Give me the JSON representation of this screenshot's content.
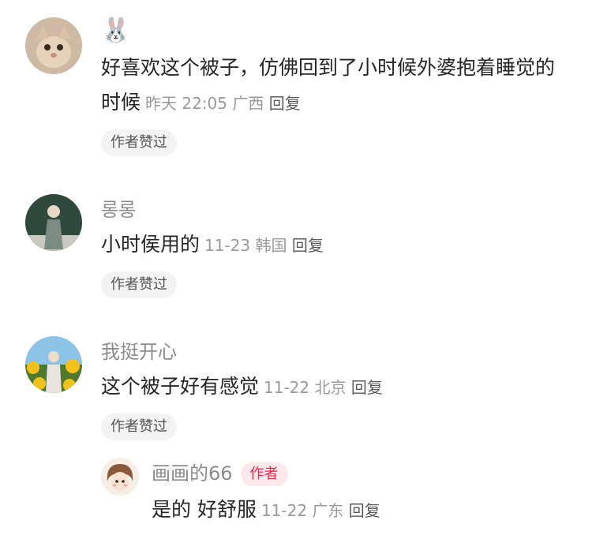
{
  "comments": [
    {
      "username": "🐰",
      "text": "好喜欢这个被子，仿佛回到了小时候外婆抱着睡觉的时候",
      "time": "昨天 22:05",
      "location": "广西",
      "reply": "回复",
      "badge": "作者赞过"
    },
    {
      "username": "롱롱",
      "text": "小时侯用的",
      "time": "11-23",
      "location": "韩国",
      "reply": "回复",
      "badge": "作者赞过"
    },
    {
      "username": "我挺开心",
      "text": "这个被子好有感觉",
      "time": "11-22",
      "location": "北京",
      "reply": "回复",
      "badge": "作者赞过"
    }
  ],
  "reply_item": {
    "username": "画画的66",
    "author_tag": "作者",
    "text": "是的 好舒服",
    "time": "11-22",
    "location": "广东",
    "reply": "回复"
  },
  "colors": {
    "author_tag_text": "#f0284a",
    "author_tag_bg": "#fde8ec",
    "badge_bg": "#f3f3f3"
  }
}
